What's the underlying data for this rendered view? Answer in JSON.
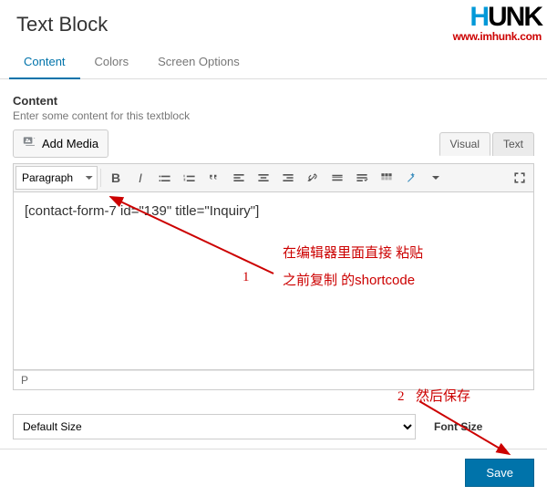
{
  "modal": {
    "title": "Text Block"
  },
  "tabs": {
    "content": "Content",
    "colors": "Colors",
    "screen": "Screen Options"
  },
  "section": {
    "label": "Content",
    "hint": "Enter some content for this textblock",
    "add_media": "Add Media"
  },
  "editor_tabs": {
    "visual": "Visual",
    "text": "Text"
  },
  "toolbar": {
    "paragraph": "Paragraph"
  },
  "editor": {
    "content": "[contact-form-7 id=\"139\" title=\"Inquiry\"]",
    "status": "P"
  },
  "footer": {
    "default_size": "Default Size",
    "font_size_label": "Font Size",
    "save": "Save"
  },
  "watermark": {
    "brand_pre": "H",
    "brand_rest": "UNK",
    "url": "www.imhunk.com"
  },
  "annotations": {
    "one_num": "1",
    "one_line1": "在编辑器里面直接 粘贴",
    "one_line2": "之前复制 的shortcode",
    "two_num": "2",
    "two_text": "然后保存"
  }
}
